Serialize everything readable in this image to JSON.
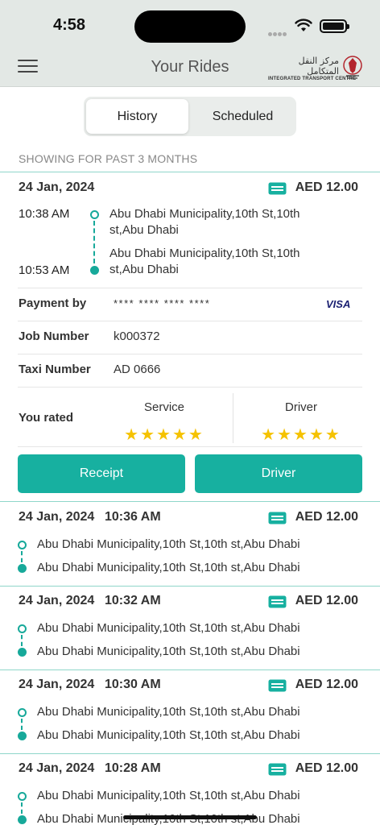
{
  "status_bar": {
    "time": "4:58"
  },
  "header": {
    "title": "Your Rides",
    "logo_arabic": "مركز النقل المتكامل",
    "logo_english": "INTEGRATED TRANSPORT CENTRE"
  },
  "tabs": {
    "history": "History",
    "scheduled": "Scheduled",
    "active": "History"
  },
  "filter_text": "SHOWING FOR PAST 3 MONTHS",
  "expanded_ride": {
    "date": "24 Jan, 2024",
    "fare": "AED 12.00",
    "pickup_time": "10:38 AM",
    "pickup_address": "Abu Dhabi Municipality,10th St,10th st,Abu Dhabi",
    "dropoff_time": "10:53 AM",
    "dropoff_address": "Abu Dhabi Municipality,10th St,10th st,Abu Dhabi",
    "payment_label": "Payment by",
    "payment_value": "**** **** **** ****",
    "card_brand": "VISA",
    "job_label": "Job Number",
    "job_value": "k000372",
    "taxi_label": "Taxi Number",
    "taxi_value": "AD 0666",
    "rated_label": "You rated",
    "service_label": "Service",
    "service_rating": 5,
    "driver_label": "Driver",
    "driver_rating": 5,
    "service_stars": "★★★★★",
    "driver_stars": "★★★★★",
    "receipt_button": "Receipt",
    "driver_button": "Driver"
  },
  "rides": [
    {
      "date": "24 Jan, 2024",
      "time": "10:36 AM",
      "fare": "AED 12.00",
      "pickup": "Abu Dhabi Municipality,10th St,10th st,Abu Dhabi",
      "dropoff": "Abu Dhabi Municipality,10th St,10th st,Abu Dhabi"
    },
    {
      "date": "24 Jan, 2024",
      "time": "10:32 AM",
      "fare": "AED 12.00",
      "pickup": "Abu Dhabi Municipality,10th St,10th st,Abu Dhabi",
      "dropoff": "Abu Dhabi Municipality,10th St,10th st,Abu Dhabi"
    },
    {
      "date": "24 Jan, 2024",
      "time": "10:30 AM",
      "fare": "AED 12.00",
      "pickup": "Abu Dhabi Municipality,10th St,10th st,Abu Dhabi",
      "dropoff": "Abu Dhabi Municipality,10th St,10th st,Abu Dhabi"
    },
    {
      "date": "24 Jan, 2024",
      "time": "10:28 AM",
      "fare": "AED 12.00",
      "pickup": "Abu Dhabi Municipality,10th St,10th st,Abu Dhabi",
      "dropoff": "Abu Dhabi Municipality,10th St,10th st,Abu Dhabi"
    }
  ],
  "colors": {
    "accent": "#17b0a0",
    "header_bg": "#e3e8e5",
    "star": "#f5c200"
  },
  "icons": {
    "menu": "hamburger-icon",
    "fare": "credit-card-icon",
    "pickup": "hollow-circle-icon",
    "dropoff": "filled-circle-icon"
  }
}
